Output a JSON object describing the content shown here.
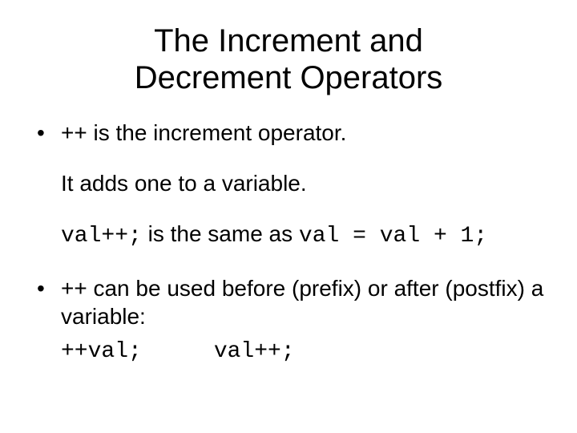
{
  "title_line1": "The Increment and",
  "title_line2": "Decrement Operators",
  "bullet1": {
    "line1": "++ is the increment operator.",
    "line2": "It adds one to a variable.",
    "code1": "val++;",
    "mid": " is the same as ",
    "code2": "val = val + 1;"
  },
  "bullet2": {
    "text": "++ can be used before (prefix) or after (postfix) a variable:",
    "code1": "++val;",
    "code2": "val++;"
  }
}
